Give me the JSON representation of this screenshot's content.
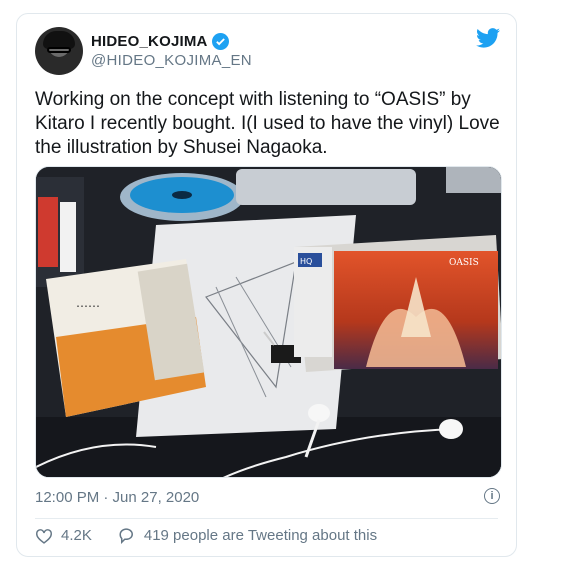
{
  "tweet": {
    "display_name": "HIDEO_KOJIMA",
    "handle": "@HIDEO_KOJIMA_EN",
    "text": "Working on the concept with listening to “OASIS” by Kitaro I recently bought. I(I used to have the vinyl) Love the illustration by Shusei Nagaoka.",
    "timestamp": "12:00 PM · Jun 27, 2020",
    "likes": "4.2K",
    "tweeting_about": "419 people are Tweeting about this"
  },
  "photo": {
    "album_title": "OASIS",
    "obi_label": "HQ"
  },
  "icons": {
    "verified": "verified-badge-icon",
    "brand": "twitter-bird-icon",
    "info": "info-icon",
    "like": "heart-icon",
    "reply": "comment-icon"
  },
  "colors": {
    "accent": "#1da1f2",
    "secondary_text": "#657786",
    "border": "#e1e8ed"
  }
}
